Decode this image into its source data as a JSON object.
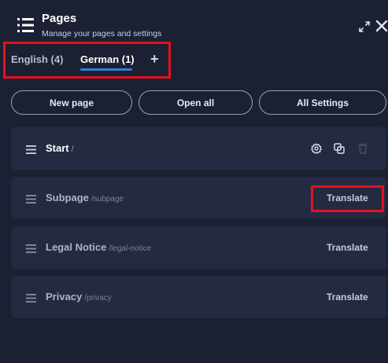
{
  "header": {
    "title": "Pages",
    "subtitle": "Manage your pages and settings"
  },
  "tabs": [
    {
      "label": "English (4)",
      "active": false
    },
    {
      "label": "German (1)",
      "active": true
    }
  ],
  "add_tab_label": "+",
  "actions": {
    "new_page": "New page",
    "open_all": "Open all",
    "all_settings": "All Settings"
  },
  "pages": [
    {
      "label": "Start",
      "path": "/",
      "enabled": true
    },
    {
      "label": "Subpage",
      "path": "/subpage",
      "action": "Translate"
    },
    {
      "label": "Legal Notice",
      "path": "/legal-notice",
      "action": "Translate"
    },
    {
      "label": "Privacy",
      "path": "/privacy",
      "action": "Translate"
    }
  ],
  "colors": {
    "background": "#1b2033",
    "row": "#232a41",
    "accent": "#2f7de1",
    "highlight": "#e8101e"
  },
  "icons": [
    "list-icon",
    "expand-icon",
    "close-icon",
    "drag-handle-icon",
    "gear-icon",
    "copy-icon",
    "trash-icon",
    "plus-icon"
  ]
}
